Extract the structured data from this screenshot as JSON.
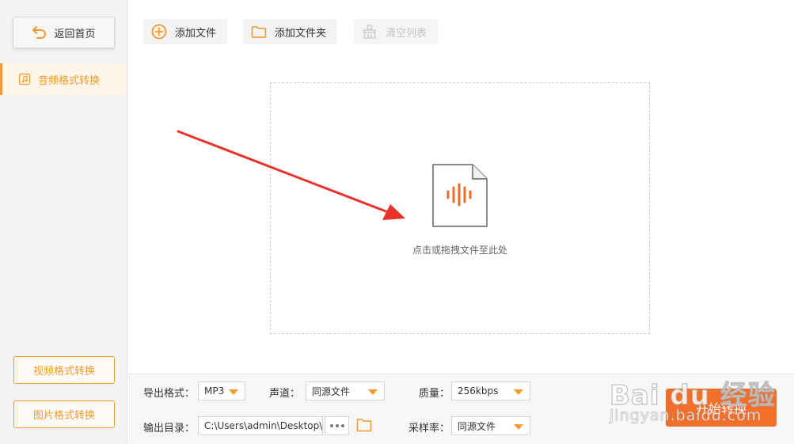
{
  "sidebar": {
    "back_label": "返回首页",
    "active_item_label": "音频格式转换",
    "video_label": "视频格式转换",
    "image_label": "图片格式转换"
  },
  "toolbar": {
    "add_file_label": "添加文件",
    "add_folder_label": "添加文件夹",
    "clear_list_label": "清空列表"
  },
  "dropzone": {
    "hint": "点击或拖拽文件至此处"
  },
  "settings": {
    "format_label": "导出格式：",
    "format_value": "MP3",
    "channel_label": "声道：",
    "channel_value": "同源文件",
    "quality_label": "质量：",
    "quality_value": "256kbps",
    "output_label": "输出目录：",
    "output_value": "C:\\Users\\admin\\Desktop\\",
    "samplerate_label": "采样率：",
    "samplerate_value": "同源文件",
    "start_label": "开始转换"
  },
  "watermark": {
    "main": "Bai du 经验",
    "sub": "jingyan.baidu.com"
  },
  "colors": {
    "accent": "#f39a2b",
    "start_button": "#f36f2a",
    "arrow": "#e8322a"
  },
  "icons": {
    "back": "back-arrow-icon",
    "music": "music-note-icon",
    "add": "plus-circle-icon",
    "folder": "folder-icon",
    "clear": "broom-icon",
    "audio_file": "audio-file-icon"
  }
}
